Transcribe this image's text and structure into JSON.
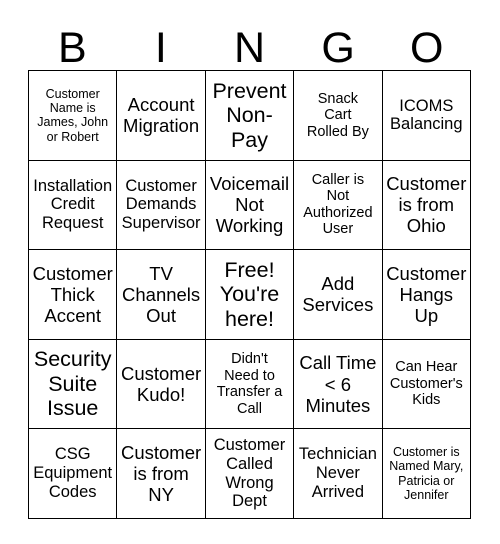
{
  "header": {
    "letters": [
      "B",
      "I",
      "N",
      "G",
      "O"
    ]
  },
  "grid": {
    "columns": 5,
    "rows": 5,
    "border_color": "#000000",
    "cell_background": "#ffffff",
    "text_color": "#000000",
    "cells": [
      {
        "text": "Customer\nName is\nJames, John\nor Robert",
        "size": "xs",
        "free": false
      },
      {
        "text": "Account\nMigration",
        "size": "lg",
        "free": false
      },
      {
        "text": "Prevent\nNon-\nPay",
        "size": "xl",
        "free": false
      },
      {
        "text": "Snack\nCart\nRolled By",
        "size": "sm",
        "free": false
      },
      {
        "text": "ICOMS\nBalancing",
        "size": "md",
        "free": false
      },
      {
        "text": "Installation\nCredit\nRequest",
        "size": "md",
        "free": false
      },
      {
        "text": "Customer\nDemands\nSupervisor",
        "size": "md",
        "free": false
      },
      {
        "text": "Voicemail\nNot\nWorking",
        "size": "lg",
        "free": false
      },
      {
        "text": "Caller is\nNot\nAuthorized\nUser",
        "size": "sm",
        "free": false
      },
      {
        "text": "Customer\nis from\nOhio",
        "size": "lg",
        "free": false
      },
      {
        "text": "Customer\nThick\nAccent",
        "size": "lg",
        "free": false
      },
      {
        "text": "TV\nChannels\nOut",
        "size": "lg",
        "free": false
      },
      {
        "text": "Free!\nYou're\nhere!",
        "size": "xl",
        "free": true
      },
      {
        "text": "Add\nServices",
        "size": "lg",
        "free": false
      },
      {
        "text": "Customer\nHangs\nUp",
        "size": "lg",
        "free": false
      },
      {
        "text": "Security\nSuite\nIssue",
        "size": "xl",
        "free": false
      },
      {
        "text": "Customer\nKudo!",
        "size": "lg",
        "free": false
      },
      {
        "text": "Didn't\nNeed to\nTransfer a\nCall",
        "size": "sm",
        "free": false
      },
      {
        "text": "Call Time\n< 6\nMinutes",
        "size": "lg",
        "free": false
      },
      {
        "text": "Can Hear\nCustomer's\nKids",
        "size": "sm",
        "free": false
      },
      {
        "text": "CSG\nEquipment\nCodes",
        "size": "md",
        "free": false
      },
      {
        "text": "Customer\nis from\nNY",
        "size": "lg",
        "free": false
      },
      {
        "text": "Customer\nCalled\nWrong\nDept",
        "size": "md",
        "free": false
      },
      {
        "text": "Technician\nNever\nArrived",
        "size": "md",
        "free": false
      },
      {
        "text": "Customer is\nNamed Mary,\nPatricia or\nJennifer",
        "size": "xs",
        "free": false
      }
    ]
  }
}
